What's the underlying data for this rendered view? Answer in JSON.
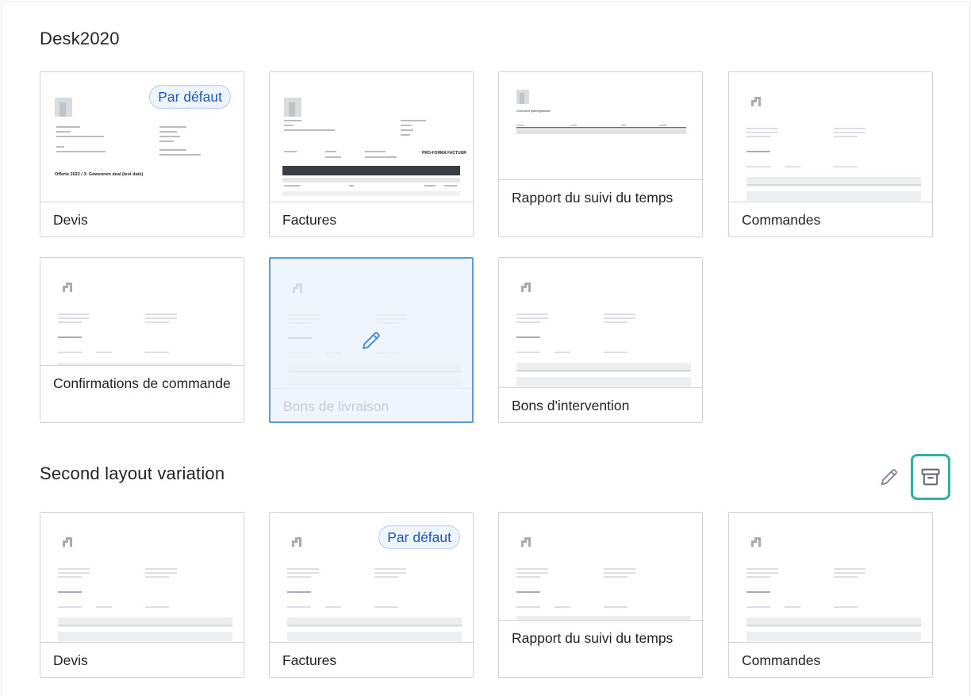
{
  "sections": [
    {
      "title": "Desk2020",
      "cards": [
        {
          "label": "Devis",
          "badge": "Par défaut",
          "preview": "doc-devis"
        },
        {
          "label": "Factures",
          "preview": "doc-factures"
        },
        {
          "label": "Rapport du suivi du temps",
          "preview": "doc-rapport"
        },
        {
          "label": "Commandes",
          "preview": "placeholder"
        },
        {
          "label": "Confirmations de commande",
          "preview": "placeholder"
        },
        {
          "label": "Bons de livraison",
          "preview": "placeholder",
          "state": "hover-edit"
        },
        {
          "label": "Bons d'intervention",
          "preview": "placeholder"
        }
      ]
    },
    {
      "title": "Second layout variation",
      "actions": [
        "pencil-icon",
        "archive-icon"
      ],
      "cards": [
        {
          "label": "Devis",
          "preview": "placeholder"
        },
        {
          "label": "Factures",
          "badge": "Par défaut",
          "preview": "placeholder"
        },
        {
          "label": "Rapport du suivi du temps",
          "preview": "placeholder"
        },
        {
          "label": "Commandes",
          "preview": "placeholder"
        }
      ]
    }
  ],
  "doc_text": {
    "devis_heading": "Offerte 2022 / 3: Gewonnen deal (test date)",
    "factures_heading": "PRO-FORMA FACTUUR",
    "rapport_heading": "Overzicht tijdsregistratie"
  },
  "colors": {
    "badge_text": "#1d56b3",
    "badge_bg": "#eef4fc",
    "selected_border": "#5b9be0",
    "archive_highlight": "#2bb3a0",
    "card_border": "#cfd3d8"
  }
}
